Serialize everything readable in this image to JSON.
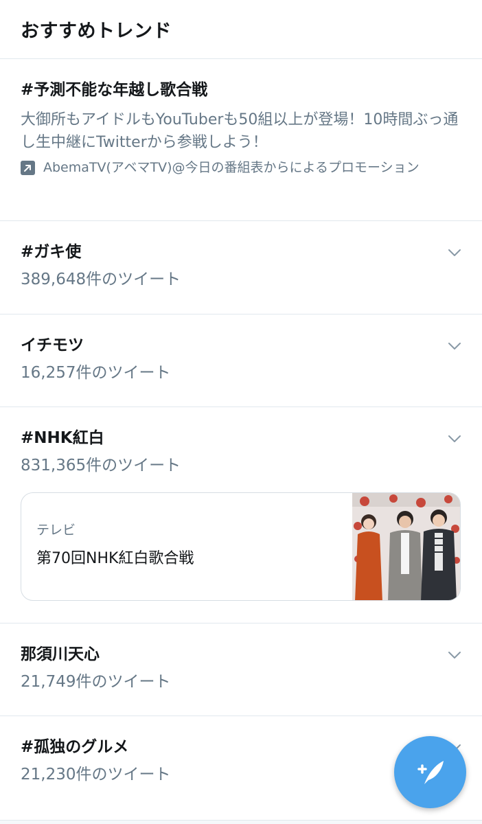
{
  "header": {
    "title": "おすすめトレンド"
  },
  "promoted": {
    "title": "#予測不能な年越し歌合戦",
    "description": "大御所もアイドルもYouTuberも50組以上が登場！10時間ぶっ通し生中継にTwitterから参戦しよう！",
    "promoted_by": "AbemaTV(アベマTV)@今日の番組表からによるプロモーション",
    "icon": "promoted-arrow-icon"
  },
  "trends": [
    {
      "title": "#ガキ使",
      "count": "389,648件のツイート"
    },
    {
      "title": "イチモツ",
      "count": "16,257件のツイート"
    },
    {
      "title": "#NHK紅白",
      "count": "831,365件のツイート",
      "card": {
        "category": "テレビ",
        "title": "第70回NHK紅白歌合戦"
      }
    },
    {
      "title": "那須川天心",
      "count": "21,749件のツイート"
    },
    {
      "title": "#孤独のグルメ",
      "count": "21,230件のツイート"
    }
  ],
  "fab": {
    "icon": "compose-tweet-icon"
  },
  "colors": {
    "accent": "#4aa3ec",
    "secondary_text": "#657786",
    "border": "#e1e8ed"
  }
}
